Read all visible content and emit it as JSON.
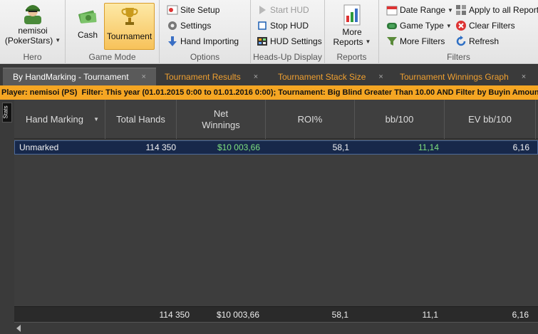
{
  "ribbon": {
    "hero": {
      "name": "nemisoi",
      "site": "(PokerStars)",
      "label": "Hero"
    },
    "game_mode": {
      "cash": "Cash",
      "tournament": "Tournament",
      "label": "Game Mode"
    },
    "options": {
      "site_setup": "Site Setup",
      "settings": "Settings",
      "hand_importing": "Hand Importing",
      "label": "Options"
    },
    "hud": {
      "start": "Start HUD",
      "stop": "Stop HUD",
      "settings": "HUD Settings",
      "label": "Heads-Up Display"
    },
    "reports": {
      "more_line1": "More",
      "more_line2": "Reports",
      "label": "Reports"
    },
    "filters": {
      "date_range": "Date Range",
      "game_type": "Game Type",
      "more_filters": "More Filters",
      "apply_all": "Apply to all Reports",
      "clear": "Clear Filters",
      "refresh": "Refresh",
      "label": "Filters"
    }
  },
  "tabs": [
    {
      "label": "By HandMarking - Tournament",
      "close": "×"
    },
    {
      "label": "Tournament Results",
      "close": "×"
    },
    {
      "label": "Tournament Stack Size",
      "close": "×"
    },
    {
      "label": "Tournament Winnings Graph",
      "close": "×"
    }
  ],
  "filter_bar": {
    "player_label": "Player:",
    "player": "nemisoi (PS)",
    "filter_label": "Filter:",
    "text": "This year (01.01.2015 0:00 to 01.01.2016 0:00); Tournament: Big Blind Greater Than 10.00 AND Filter by Buyin Amount Less"
  },
  "side_tab": "Stats",
  "table": {
    "columns": [
      "Hand Marking",
      "Total Hands",
      "Net Winnings",
      "ROI%",
      "bb/100",
      "EV bb/100"
    ],
    "net_winnings_l1": "Net",
    "net_winnings_l2": "Winnings",
    "rows": [
      {
        "hand_marking": "Unmarked",
        "total_hands": "114 350",
        "net_winnings": "$10 003,66",
        "roi": "58,1",
        "bb100": "11,14",
        "ev_bb100": "6,16"
      }
    ],
    "totals": {
      "total_hands": "114 350",
      "net_winnings": "$10 003,66",
      "roi": "58,1",
      "bb100": "11,1",
      "ev_bb100": "6,16"
    }
  },
  "colors": {
    "accent_orange": "#f5a623",
    "selection_row": "#17284a",
    "positive_green": "#7ee07e"
  }
}
